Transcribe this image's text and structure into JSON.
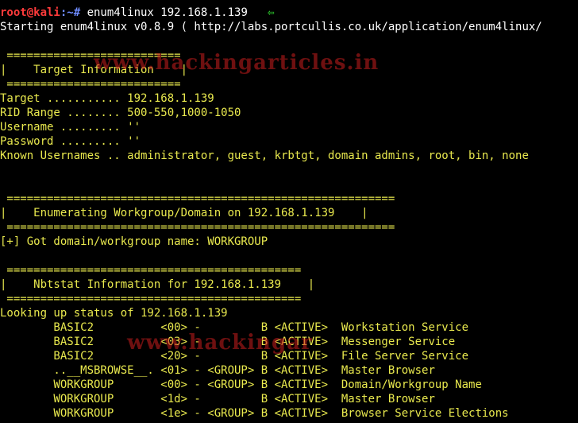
{
  "prompt": {
    "user_host": "root@kali",
    "path_sep": ":~# ",
    "command": "enum4linux 192.168.1.139",
    "arrow_icon": "left-arrow-icon"
  },
  "banner": "Starting enum4linux v0.8.9 ( http://labs.portcullis.co.uk/application/enum4linux/",
  "sections": {
    "target_border": " ==========================",
    "target_title": "|    Target Information    |",
    "workgroup_border": " ==========================================================",
    "workgroup_title": "|    Enumerating Workgroup/Domain on 192.168.1.139    |",
    "nbt_border": " ============================================",
    "nbt_title": "|    Nbtstat Information for 192.168.1.139    |"
  },
  "target_info": [
    "Target ........... 192.168.1.139",
    "RID Range ........ 500-550,1000-1050",
    "Username ......... ''",
    "Password ......... ''",
    "Known Usernames .. administrator, guest, krbtgt, domain admins, root, bin, none"
  ],
  "workgroup_result": "[+] Got domain/workgroup name: WORKGROUP",
  "nbt_lookup": "Looking up status of 192.168.1.139",
  "nbt_rows": [
    "        BASIC2          <00> -         B <ACTIVE>  Workstation Service",
    "        BASIC2          <03> -         B <ACTIVE>  Messenger Service",
    "        BASIC2          <20> -         B <ACTIVE>  File Server Service",
    "        ..__MSBROWSE__. <01> - <GROUP> B <ACTIVE>  Master Browser",
    "        WORKGROUP       <00> - <GROUP> B <ACTIVE>  Domain/Workgroup Name",
    "        WORKGROUP       <1d> -         B <ACTIVE>  Master Browser",
    "        WORKGROUP       <1e> - <GROUP> B <ACTIVE>  Browser Service Elections"
  ],
  "watermark": {
    "text": "www.hackingarticles.in",
    "partial": "www.hackingar"
  },
  "colors": {
    "background": "#000000",
    "output": "#e9e94e",
    "command": "#ffffff",
    "user": "#ff3b3b",
    "path": "#6f8cff",
    "arrow": "#2fd42f"
  }
}
